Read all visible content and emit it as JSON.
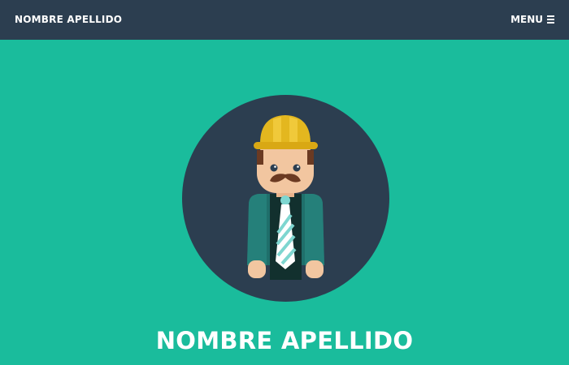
{
  "navbar": {
    "brand": "NOMBRE APELLIDO",
    "menu_label": "MENU",
    "menu_icon": "hamburger-icon"
  },
  "masthead": {
    "avatar_icon": "construction-worker-avatar",
    "title": "NOMBRE APELLIDO"
  },
  "colors": {
    "background": "#1abc9c",
    "navbar": "#2c3e50",
    "avatar_circle": "#2c3e50",
    "text": "#ffffff"
  }
}
